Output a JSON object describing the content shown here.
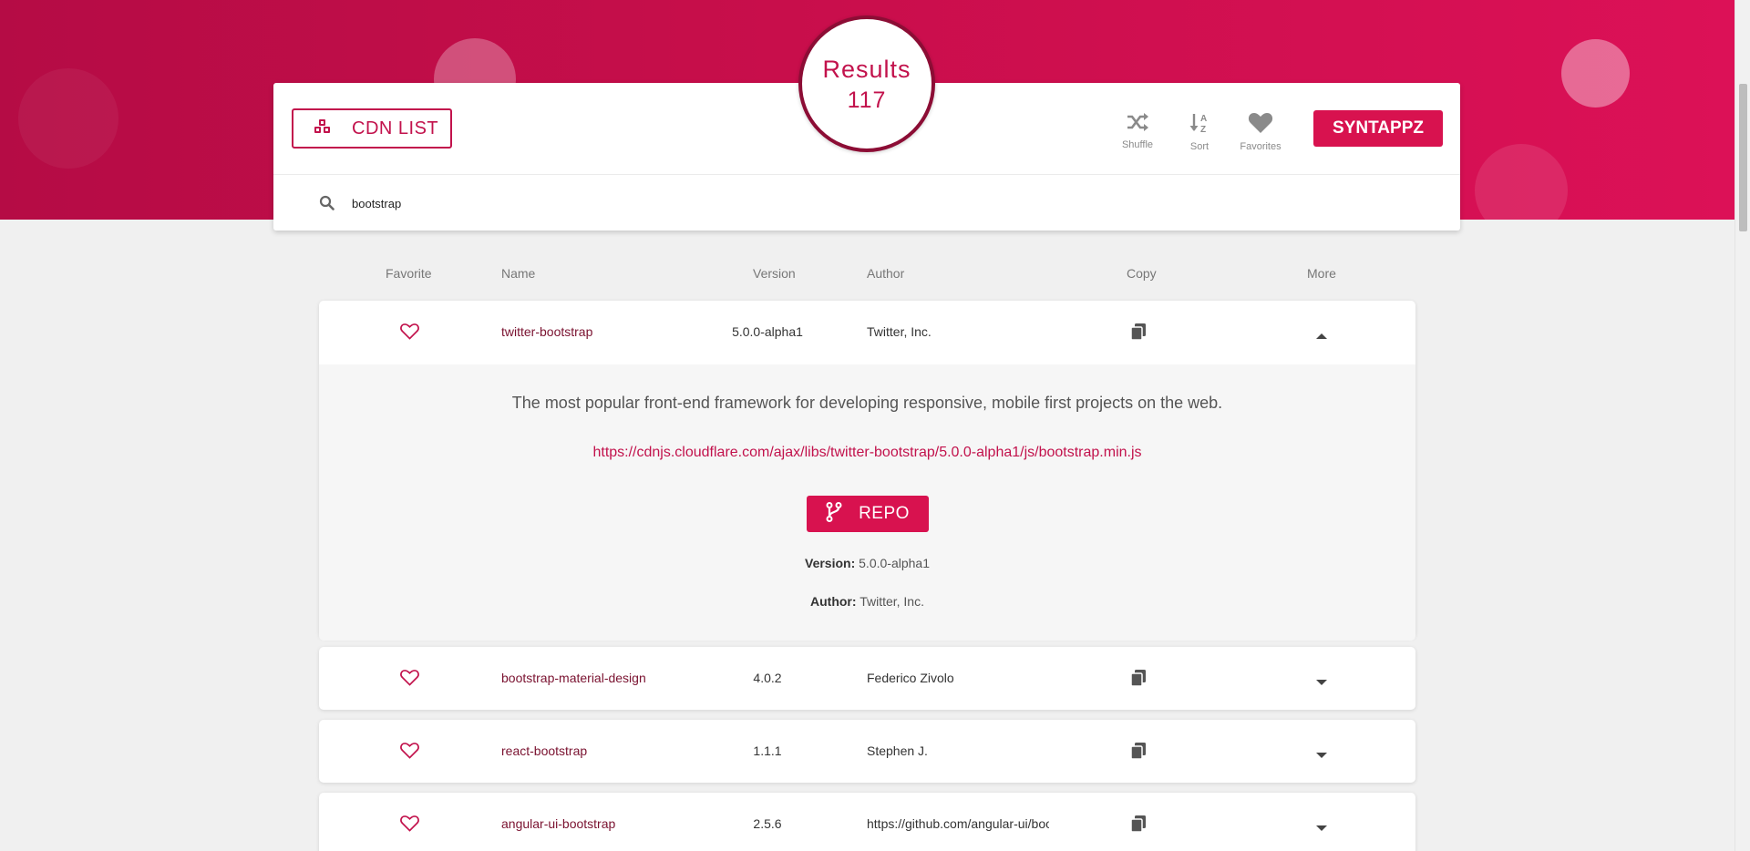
{
  "header": {
    "cdn_button_label": "CDN LIST",
    "results_label": "Results",
    "results_count": "117",
    "tools": {
      "shuffle": "Shuffle",
      "sort": "Sort",
      "favorites": "Favorites"
    },
    "brand_button_label": "SYNTAPPZ"
  },
  "search": {
    "value": "bootstrap"
  },
  "columns": {
    "favorite": "Favorite",
    "name": "Name",
    "version": "Version",
    "author": "Author",
    "copy": "Copy",
    "more": "More"
  },
  "rows": [
    {
      "name": "twitter-bootstrap",
      "version": "5.0.0-alpha1",
      "author": "Twitter, Inc.",
      "expanded": true
    },
    {
      "name": "bootstrap-material-design",
      "version": "4.0.2",
      "author": "Federico Zivolo",
      "expanded": false
    },
    {
      "name": "react-bootstrap",
      "version": "1.1.1",
      "author": "Stephen J.",
      "expanded": false
    },
    {
      "name": "angular-ui-bootstrap",
      "version": "2.5.6",
      "author": "https://github.com/angular-ui/bootstrap",
      "expanded": false
    }
  ],
  "detail": {
    "description": "The most popular front-end framework for developing responsive, mobile first projects on the web.",
    "url": "https://cdnjs.cloudflare.com/ajax/libs/twitter-bootstrap/5.0.0-alpha1/js/bootstrap.min.js",
    "repo_label": "REPO",
    "version_key": "Version:",
    "version_value": "5.0.0-alpha1",
    "author_key": "Author:",
    "author_value": "Twitter, Inc."
  },
  "colors": {
    "accent": "#d8124f",
    "accent_dark": "#8c0d35",
    "name_text": "#7a1230"
  },
  "icons": [
    "cubes-icon",
    "shuffle-icon",
    "sort-alpha-icon",
    "heart-icon",
    "search-icon",
    "heart-outline-icon",
    "copy-icon",
    "caret-up-icon",
    "caret-down-icon",
    "code-branch-icon"
  ]
}
